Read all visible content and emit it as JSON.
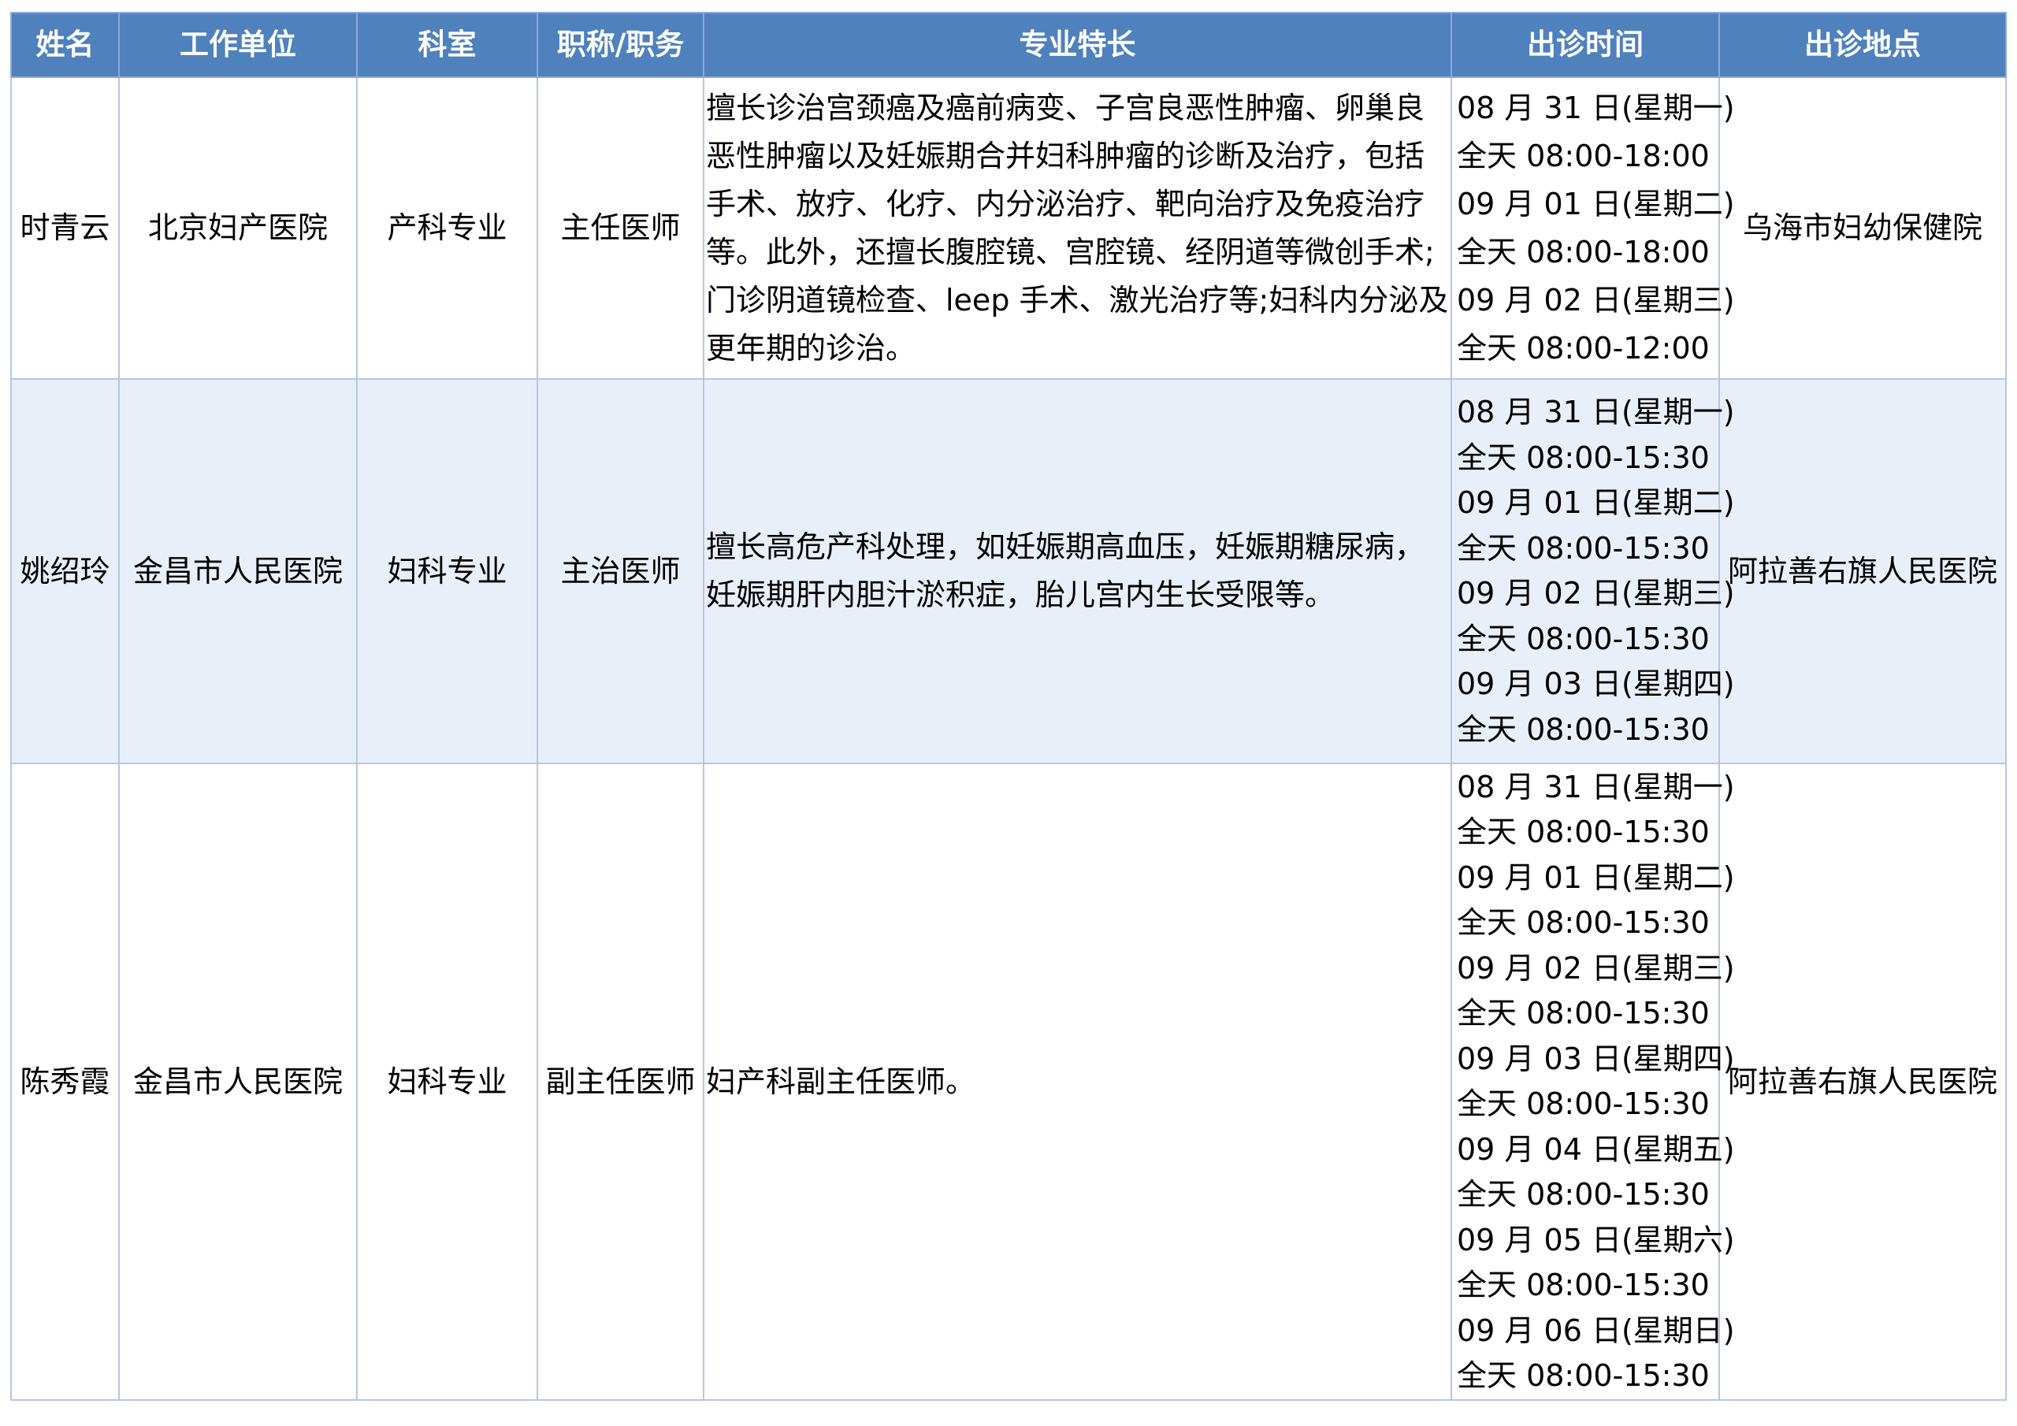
{
  "table": {
    "headers": {
      "name": "姓名",
      "unit": "工作单位",
      "department": "科室",
      "title": "职称/职务",
      "specialty": "专业特长",
      "schedule": "出诊时间",
      "location": "出诊地点"
    },
    "rows": [
      {
        "name": "时青云",
        "unit": "北京妇产医院",
        "department": "产科专业",
        "title": "主任医师",
        "specialty": "擅长诊治宫颈癌及癌前病变、子宫良恶性肿瘤、卵巢良恶性肿瘤以及妊娠期合并妇科肿瘤的诊断及治疗，包括手术、放疗、化疗、内分泌治疗、靶向治疗及免疫治疗等。此外，还擅长腹腔镜、宫腔镜、经阴道等微创手术;门诊阴道镜检查、leep 手术、激光治疗等;妇科内分泌及更年期的诊治。",
        "schedule": [
          "08 月 31 日(星期一)",
          "全天 08:00-18:00",
          "09 月 01 日(星期二)",
          "全天 08:00-18:00",
          "09 月 02 日(星期三)",
          "全天 08:00-12:00"
        ],
        "location": "乌海市妇幼保健院"
      },
      {
        "name": "姚绍玲",
        "unit": "金昌市人民医院",
        "department": "妇科专业",
        "title": "主治医师",
        "specialty": "擅长高危产科处理，如妊娠期高血压，妊娠期糖尿病，妊娠期肝内胆汁淤积症，胎儿宫内生长受限等。",
        "schedule": [
          "08 月 31 日(星期一)",
          "全天 08:00-15:30",
          "09 月 01 日(星期二)",
          "全天 08:00-15:30",
          "09 月 02 日(星期三)",
          "全天 08:00-15:30",
          "09 月 03 日(星期四)",
          "全天 08:00-15:30"
        ],
        "location": "阿拉善右旗人民医院"
      },
      {
        "name": "陈秀霞",
        "unit": "金昌市人民医院",
        "department": "妇科专业",
        "title": "副主任医师",
        "specialty": "妇产科副主任医师。",
        "schedule": [
          "08 月 31 日(星期一)",
          "全天 08:00-15:30",
          "09 月 01 日(星期二)",
          "全天 08:00-15:30",
          "09 月 02 日(星期三)",
          "全天 08:00-15:30",
          "09 月 03 日(星期四)",
          "全天 08:00-15:30",
          "09 月 04 日(星期五)",
          "全天 08:00-15:30",
          "09 月 05 日(星期六)",
          "全天 08:00-15:30",
          "09 月 06 日(星期日)",
          "全天 08:00-15:30"
        ],
        "location": "阿拉善右旗人民医院"
      }
    ]
  },
  "colors": {
    "header_bg": "#4f81bd",
    "header_text": "#ffffff",
    "alt_row_bg": "#e9eff8",
    "border": "#b4c6e7"
  }
}
